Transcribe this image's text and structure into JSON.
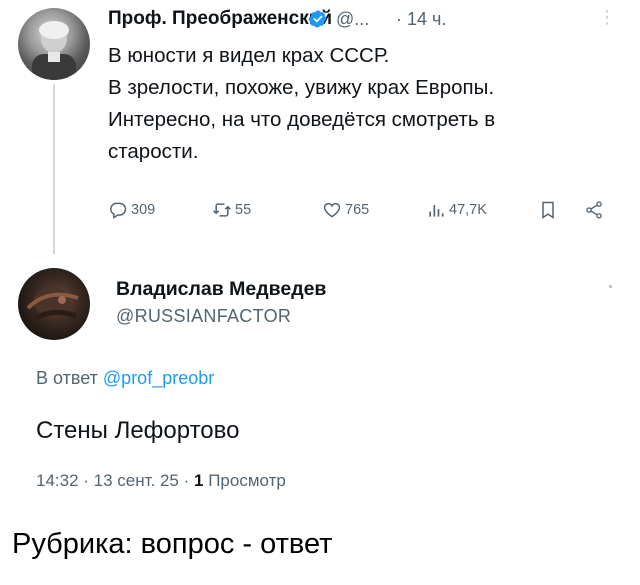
{
  "tweet1": {
    "author_name": "Проф. Преображенский",
    "handle": "@...",
    "time": "· 14 ч.",
    "more": "⋮",
    "lines": [
      "В юности я видел крах СССР.",
      "В зрелости, похоже, увижу крах Европы.",
      "Интересно, на что доведётся смотреть в",
      "старости."
    ],
    "actions": {
      "replies": "309",
      "retweets": "55",
      "likes": "765",
      "views": "47,7K"
    }
  },
  "tweet2": {
    "author_name": "Владислав Медведев",
    "handle": "@RUSSIANFACTOR",
    "reply_prefix": "В ответ",
    "reply_to": "@prof_preobr",
    "text": "Стены Лефортово",
    "meta_time": "14:32 · 13 сент. 25 ·",
    "views_count": "1",
    "views_label": "Просмотр"
  },
  "caption": "Рубрика: вопрос - ответ",
  "colors": {
    "verified": "#1d9bf0",
    "link": "#1d9bf0",
    "muted": "#536471"
  }
}
